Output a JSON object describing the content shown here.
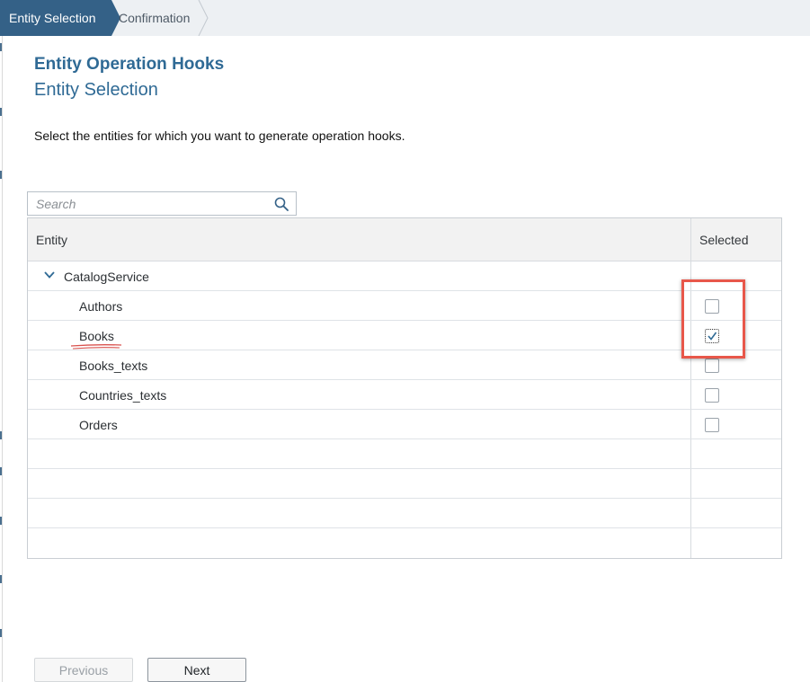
{
  "wizard": {
    "steps": [
      {
        "label": "Entity Selection",
        "active": true
      },
      {
        "label": "Confirmation",
        "active": false
      }
    ]
  },
  "page": {
    "title": "Entity Operation Hooks",
    "subtitle": "Entity Selection",
    "instruction": "Select the entities for which you want to generate operation hooks."
  },
  "search": {
    "placeholder": "Search",
    "value": "",
    "icon": "search-icon"
  },
  "table": {
    "headers": {
      "entity": "Entity",
      "selected": "Selected"
    },
    "group": {
      "label": "CatalogService",
      "expanded": true,
      "icon": "chevron-down-icon"
    },
    "rows": [
      {
        "entity": "Authors",
        "selected": false
      },
      {
        "entity": "Books",
        "selected": true
      },
      {
        "entity": "Books_texts",
        "selected": false
      },
      {
        "entity": "Countries_texts",
        "selected": false
      },
      {
        "entity": "Orders",
        "selected": false
      }
    ]
  },
  "buttons": {
    "previous": "Previous",
    "next": "Next"
  },
  "colors": {
    "accent": "#346187",
    "title": "#2f6a95",
    "annotation": "#e8574a"
  }
}
